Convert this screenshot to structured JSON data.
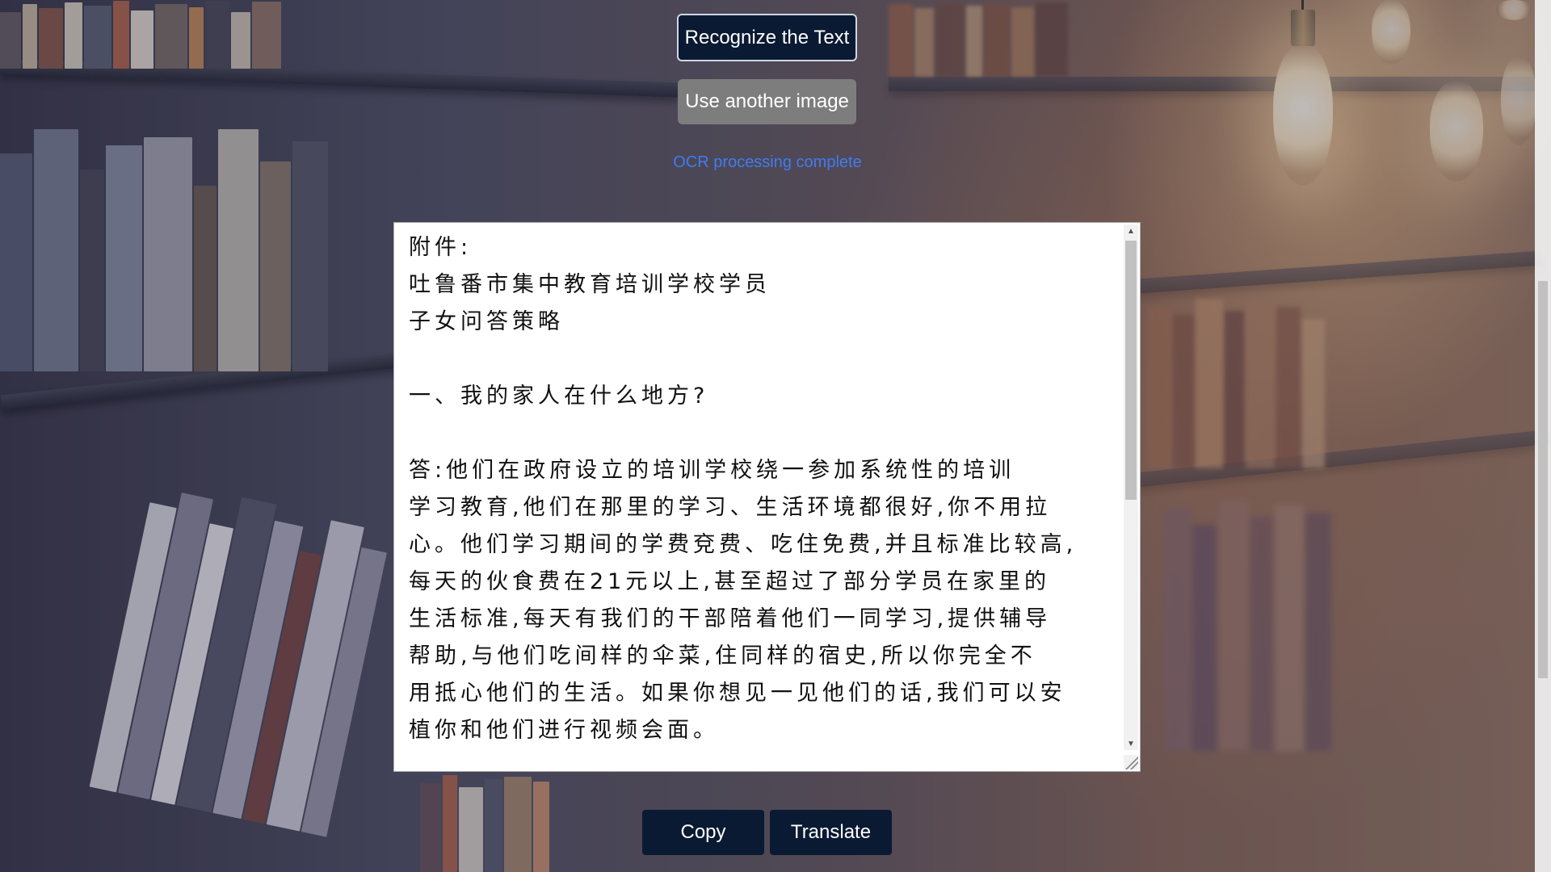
{
  "buttons": {
    "recognize": "Recognize the Text",
    "another_image": "Use another image",
    "copy": "Copy",
    "translate": "Translate"
  },
  "status": {
    "message": "OCR processing complete"
  },
  "ocr": {
    "text": "附件:\n吐鲁番市集中教育培训学校学员\n子女问答策略\n\n一、我的家人在什么地方?\n\n答:他们在政府设立的培训学校绕一参加系统性的培训\n学习教育,他们在那里的学习、生活环境都很好,你不用拉\n心。他们学习期间的学费兗费、吃住免费,并且标准比较高,\n每天的伙食费在21元以上,甚至超过了部分学员在家里的\n生活标准,每天有我们的干部陪着他们一同学习,提供辅导\n帮助,与他们吃间样的伞菜,住同样的宿史,所以你完全不\n用抵心他们的生活。如果你想见一见他们的话,我们可以安\n植你和他们进行视频会面。"
  },
  "colors": {
    "primary_button": "#0b1a33",
    "secondary_button": "#7d7d7d",
    "status_text": "#3f7cf0"
  },
  "icons": {
    "scroll_up": "▲",
    "scroll_down": "▼"
  }
}
